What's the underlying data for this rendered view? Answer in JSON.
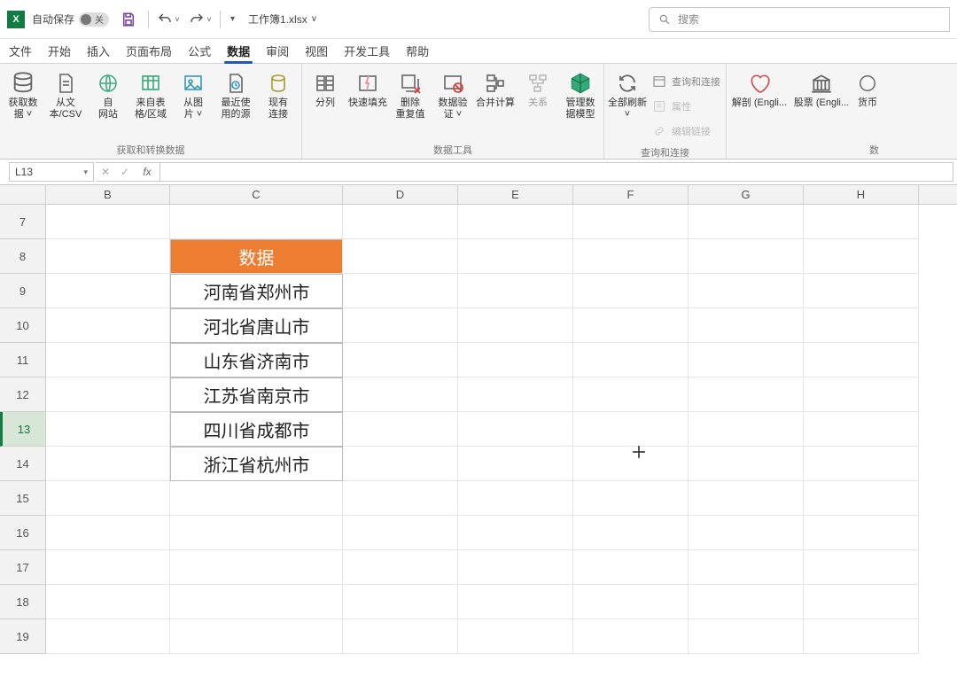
{
  "title_bar": {
    "app_abbrev": "X",
    "autosave_label": "自动保存",
    "autosave_state": "关",
    "filename": "工作簿1.xlsx"
  },
  "search": {
    "placeholder": "搜索"
  },
  "tabs": {
    "file": "文件",
    "home": "开始",
    "insert": "插入",
    "layout": "页面布局",
    "formulas": "公式",
    "data": "数据",
    "review": "审阅",
    "view": "视图",
    "dev": "开发工具",
    "help": "帮助"
  },
  "ribbon": {
    "group1_label": "获取和转换数据",
    "btn_getdata": "获取数\n据 ˅",
    "btn_fromtext": "从文\n本/CSV",
    "btn_fromweb": "自\n网站",
    "btn_fromtable": "来自表\n格/区域",
    "btn_frompic": "从图\n片 ˅",
    "btn_recent": "最近使\n用的源",
    "btn_existing": "现有\n连接",
    "group2_label": "数据工具",
    "btn_split": "分列",
    "btn_flashfill": "快速填充",
    "btn_removedup": "删除\n重复值",
    "btn_validate": "数据验\n证 ˅",
    "btn_consolidate": "合并计算",
    "btn_relations": "关系",
    "btn_model": "管理数\n据模型",
    "group3_label": "查询和连接",
    "btn_refresh": "全部刷新\n˅",
    "mini_conn": "查询和连接",
    "mini_props": "属性",
    "mini_links": "编辑链接",
    "group4_type1": "解剖 (Engli...",
    "group4_type2": "股票 (Engli...",
    "group4_type3": "货币",
    "group4_bottom": "数"
  },
  "formula_bar": {
    "namebox": "L13",
    "fx": "fx"
  },
  "columns": [
    "",
    "B",
    "C",
    "D",
    "E",
    "F",
    "G",
    "H"
  ],
  "rows_visible": [
    7,
    8,
    9,
    10,
    11,
    12,
    13,
    14,
    15,
    16,
    17,
    18,
    19
  ],
  "selected_row": 13,
  "table": {
    "header": "数据",
    "cells": [
      "河南省郑州市",
      "河北省唐山市",
      "山东省济南市",
      "江苏省南京市",
      "四川省成都市",
      "浙江省杭州市"
    ]
  }
}
